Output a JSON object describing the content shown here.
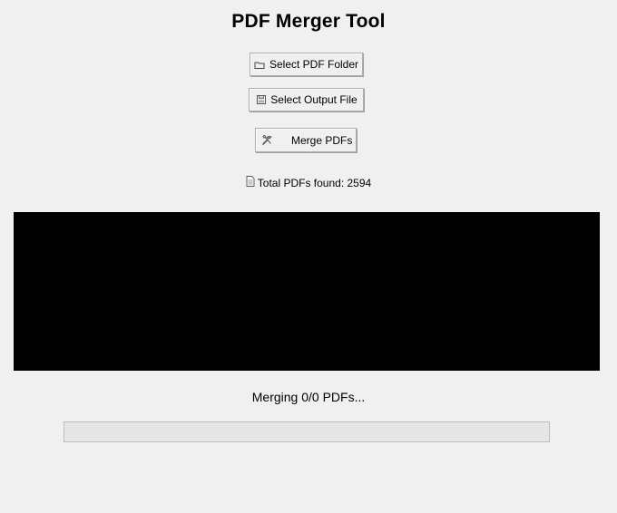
{
  "app": {
    "title": "PDF Merger Tool"
  },
  "buttons": {
    "select_folder": {
      "label": "Select PDF Folder",
      "icon": "folder-icon"
    },
    "select_output": {
      "label": "Select Output File",
      "icon": "save-file-icon"
    },
    "merge": {
      "label": "Merge PDFs",
      "icon": "tools-icon"
    }
  },
  "summary": {
    "total_label": "Total PDFs found: 2594",
    "icon": "document-icon"
  },
  "status": {
    "text": "Merging 0/0 PDFs..."
  },
  "progress": {
    "value_percent": 0
  },
  "colors": {
    "background": "#f0f0f0",
    "log_background": "#000000"
  }
}
